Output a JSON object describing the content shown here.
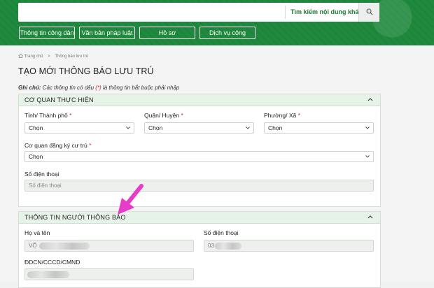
{
  "header": {
    "search": {
      "placeholder": "",
      "hint": "Tìm kiếm nội dung khác"
    },
    "nav": [
      "Thông tin công dân",
      "Văn bản pháp luật",
      "Hồ sơ",
      "Dịch vụ công"
    ]
  },
  "breadcrumb": {
    "home": "Trang chủ",
    "separator": ">",
    "current": "Thông báo lưu trú"
  },
  "page": {
    "title": "TẠO MỚI THÔNG BÁO LƯU TRÚ",
    "note_label": "Ghi chú:",
    "note_text_before": " Các thông tin có dấu ",
    "note_star": "(*)",
    "note_text_after": " là thông tin bắt buộc phải nhập"
  },
  "section1": {
    "title": "CƠ QUAN THỰC HIỆN",
    "province": {
      "label": "Tỉnh/ Thành phố",
      "required": "*",
      "value": "Chọn"
    },
    "district": {
      "label": "Quận/ Huyện",
      "required": "*",
      "value": "Chọn"
    },
    "ward": {
      "label": "Phường/ Xã",
      "required": "*",
      "value": "Chọn"
    },
    "agency": {
      "label": "Cơ quan đăng ký cư trú",
      "required": "*",
      "value": "Chọn"
    },
    "phone": {
      "label": "Số điện thoại",
      "placeholder": "Số điện thoại"
    }
  },
  "section2": {
    "title": "THÔNG TIN NGƯỜI THÔNG BÁO",
    "name": {
      "label": "Họ và tên",
      "value_visible": "VÕ"
    },
    "phone": {
      "label": "Số điện thoại",
      "value_visible": "03"
    },
    "id": {
      "label": "ĐDCN/CCCD/CMND"
    }
  },
  "colors": {
    "brand_green": "#1f8a3d",
    "section_head": "#e7f2e9",
    "required_red": "#d4272b",
    "arrow_magenta": "#e63cc8"
  }
}
